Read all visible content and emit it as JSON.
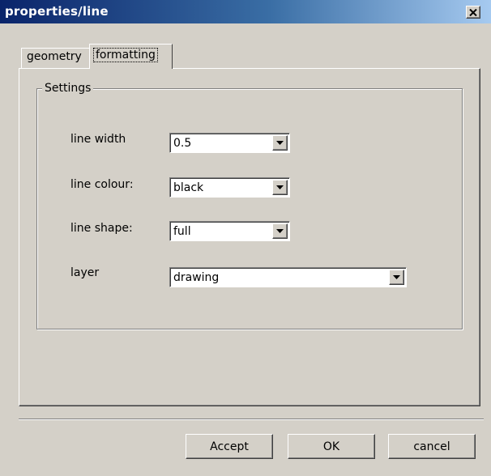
{
  "window": {
    "title": "properties/line"
  },
  "tabs": [
    {
      "label": "geometry",
      "selected": false
    },
    {
      "label": "formatting",
      "selected": true
    }
  ],
  "settings": {
    "group_label": "Settings",
    "fields": [
      {
        "label": "line width",
        "value": "0.5"
      },
      {
        "label": "line colour:",
        "value": "black"
      },
      {
        "label": "line shape:",
        "value": "full"
      },
      {
        "label": "layer",
        "value": "drawing"
      }
    ]
  },
  "buttons": {
    "accept": "Accept",
    "ok": "OK",
    "cancel": "cancel"
  },
  "icons": {
    "close": "close-icon",
    "dropdown": "chevron-down-icon"
  }
}
